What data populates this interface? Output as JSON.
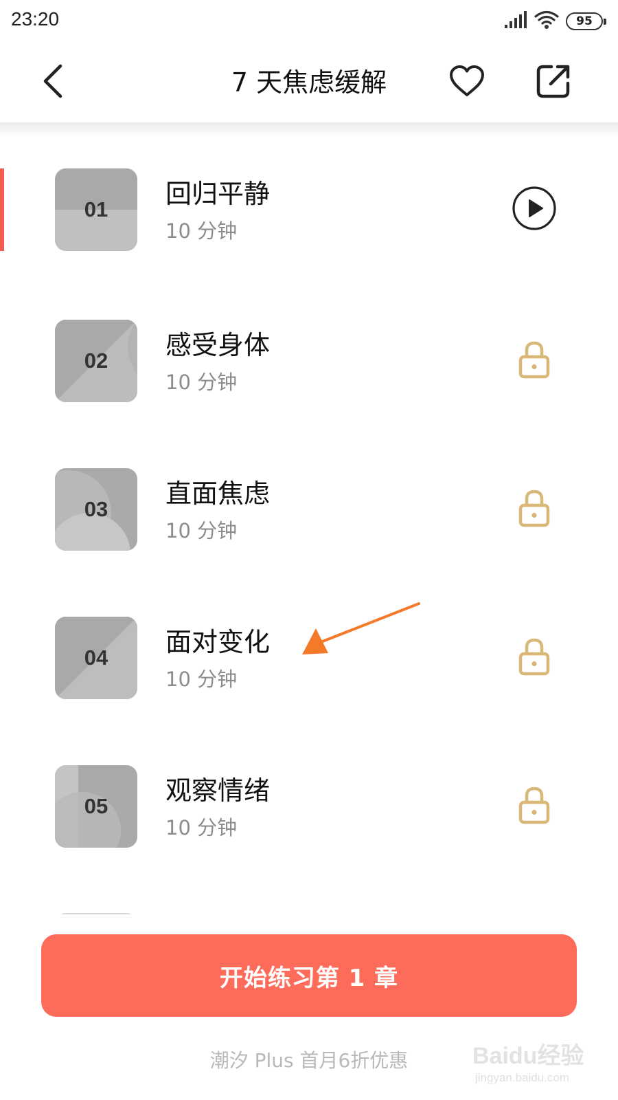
{
  "status_bar": {
    "time": "23:20",
    "battery": "95",
    "icons": [
      "signal-icon",
      "wifi-icon",
      "battery-icon"
    ]
  },
  "header": {
    "title": "7 天焦虑缓解",
    "icons": [
      "back-chevron-icon",
      "heart-icon",
      "share-icon"
    ]
  },
  "lessons": [
    {
      "number": "01",
      "title": "回归平静",
      "duration": "10 分钟",
      "status": "playable",
      "active": true
    },
    {
      "number": "02",
      "title": "感受身体",
      "duration": "10 分钟",
      "status": "locked",
      "active": false
    },
    {
      "number": "03",
      "title": "直面焦虑",
      "duration": "10 分钟",
      "status": "locked",
      "active": false
    },
    {
      "number": "04",
      "title": "面对变化",
      "duration": "10 分钟",
      "status": "locked",
      "active": false
    },
    {
      "number": "05",
      "title": "观察情绪",
      "duration": "10 分钟",
      "status": "locked",
      "active": false
    }
  ],
  "start_button": {
    "label": "开始练习第 1 章"
  },
  "promo_text": "潮汐 Plus 首月6折优惠",
  "watermark": {
    "logo": "Baidu经验",
    "sub": "jingyan.baidu.com"
  },
  "colors": {
    "accent": "#fd6b5a",
    "active_indicator": "#f25a52",
    "lock": "#d9b877",
    "thumbnail": "#b7b7b7",
    "annotation_arrow": "#f47a2a"
  }
}
